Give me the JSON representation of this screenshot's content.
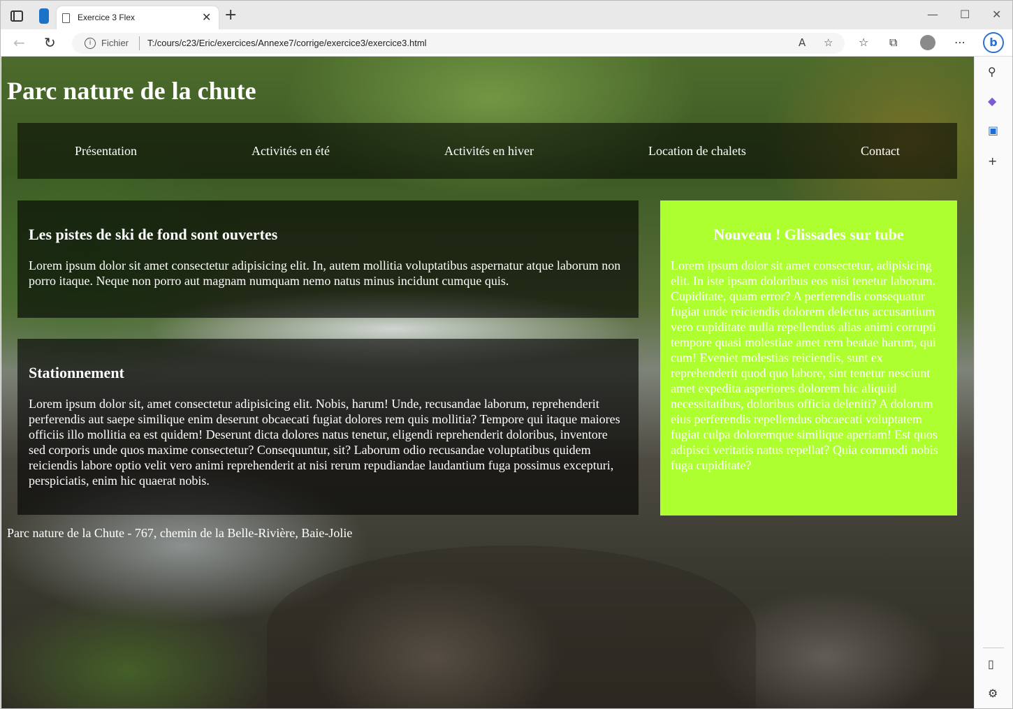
{
  "browser": {
    "tab_title": "Exercice 3 Flex",
    "tab_close": "✕",
    "new_tab": "+",
    "address_scheme": "Fichier",
    "address_url": "T:/cours/c23/Eric/exercices/Annexe7/corrige/exercice3/exercice3.html",
    "icons": [
      "tab-actions-icon",
      "workspaces-icon",
      "back-icon",
      "refresh-icon",
      "info-icon",
      "read-aloud-icon",
      "favorite-add-icon",
      "favorites-icon",
      "collections-icon",
      "profile-icon",
      "more-icon",
      "bing-icon",
      "minimize-icon",
      "maximize-icon",
      "close-icon"
    ]
  },
  "sidebar": {
    "icons": [
      "search-icon",
      "copilot-icon",
      "outlook-icon",
      "add-icon",
      "sidebar-toggle-icon",
      "settings-icon"
    ]
  },
  "page": {
    "title": "Parc nature de la chute",
    "nav": [
      "Présentation",
      "Activités en été",
      "Activités en hiver",
      "Location de chalets",
      "Contact"
    ],
    "articles": [
      {
        "heading": "Les pistes de ski de fond sont ouvertes",
        "text": "Lorem ipsum dolor sit amet consectetur adipisicing elit. In, autem mollitia voluptatibus aspernatur atque laborum non porro itaque. Neque non porro aut magnam numquam nemo natus minus incidunt cumque quis."
      },
      {
        "heading": "Stationnement",
        "text": "Lorem ipsum dolor sit, amet consectetur adipisicing elit. Nobis, harum! Unde, recusandae laborum, reprehenderit perferendis aut saepe similique enim deserunt obcaecati fugiat dolores rem quis mollitia? Tempore qui itaque maiores officiis illo mollitia ea est quidem! Deserunt dicta dolores natus tenetur, eligendi reprehenderit doloribus, inventore sed corporis unde quos maxime consectetur? Consequuntur, sit? Laborum odio recusandae voluptatibus quidem reiciendis labore optio velit vero animi reprehenderit at nisi rerum repudiandae laudantium fuga possimus excepturi, perspiciatis, enim hic quaerat nobis."
      }
    ],
    "aside": {
      "heading": "Nouveau ! Glissades sur tube",
      "text": "Lorem ipsum dolor sit amet consectetur, adipisicing elit. In iste ipsam doloribus eos nisi tenetur laborum. Cupiditate, quam error? A perferendis consequatur fugiat unde reiciendis dolorem delectus accusantium vero cupiditate nulla repellendus alias animi corrupti tempore quasi molestiae amet rem beatae harum, qui cum! Eveniet molestias reiciendis, sunt ex reprehenderit quod quo labore, sint tenetur nesciunt amet expedita asperiores dolorem hic aliquid necessitatibus, doloribus officia deleniti? A dolorum eius perferendis repellendus obcaecati voluptatem fugiat culpa doloremque similique aperiam! Est quos adipisci veritatis natus repellat? Quia commodi nobis fuga cupiditate?",
      "background": "#adff2f"
    },
    "footer": "Parc nature de la Chute - 767, chemin de la Belle-Rivière, Baie-Jolie"
  }
}
